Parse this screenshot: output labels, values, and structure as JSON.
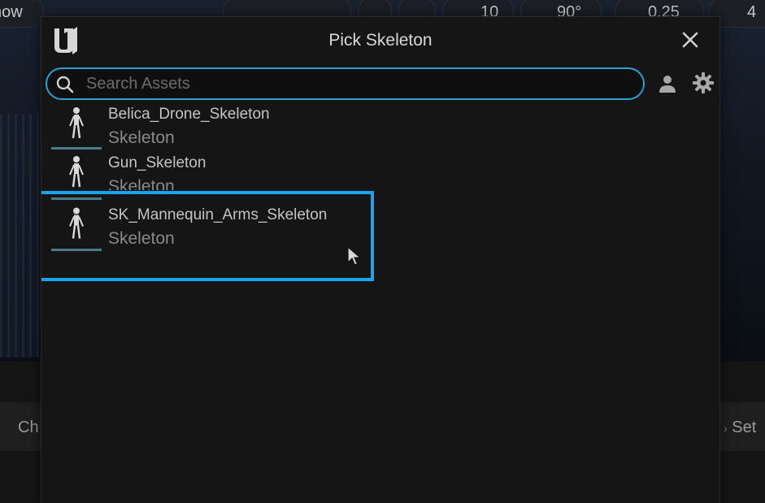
{
  "background": {
    "toolbar": {
      "left_label": "how",
      "grid_value": "10",
      "angle_value": "90°",
      "scale_value": "0.25",
      "camera_value": "4"
    },
    "bottom_left_text": "Ch",
    "bottom_right_text": "Set"
  },
  "dialog": {
    "title": "Pick Skeleton",
    "search": {
      "placeholder": "Search Assets",
      "value": ""
    },
    "assets": [
      {
        "name": "Belica_Drone_Skeleton",
        "type": "Skeleton"
      },
      {
        "name": "Gun_Skeleton",
        "type": "Skeleton"
      },
      {
        "name": "SK_Mannequin_Arms_Skeleton",
        "type": "Skeleton"
      }
    ],
    "highlight_color": "#17a4f0",
    "accent_color": "#2b9fd6"
  }
}
